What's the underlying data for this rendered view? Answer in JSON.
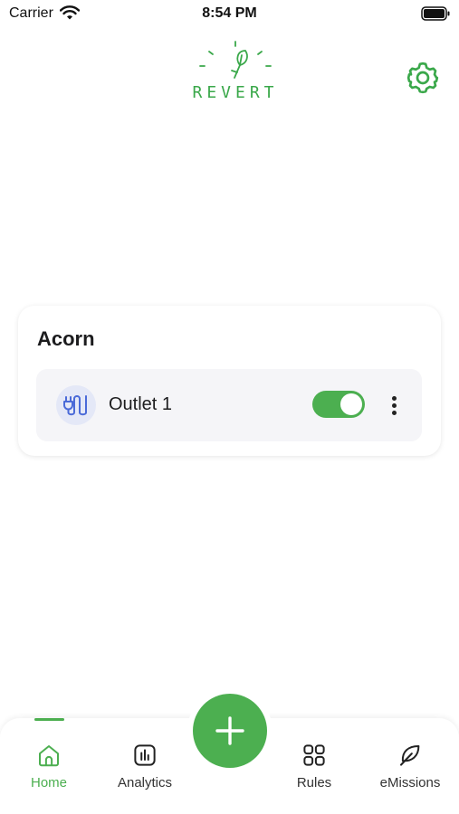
{
  "status_bar": {
    "carrier": "Carrier",
    "time": "8:54 PM"
  },
  "header": {
    "logo_text": "REVERT",
    "settings_icon": "gear-icon"
  },
  "device_group": {
    "name": "Acorn",
    "outlets": [
      {
        "name": "Outlet 1",
        "icon": "plug-icon",
        "power_on": true
      }
    ]
  },
  "tab_bar": {
    "tabs": [
      {
        "label": "Home",
        "icon": "home-icon",
        "active": true
      },
      {
        "label": "Analytics",
        "icon": "chart-icon",
        "active": false
      },
      {
        "label": "Rules",
        "icon": "grid-icon",
        "active": false
      },
      {
        "label": "eMissions",
        "icon": "leaf-icon",
        "active": false
      }
    ],
    "add_icon": "plus-icon"
  },
  "colors": {
    "accent": "#4caf50",
    "logo": "#3aa84a",
    "outlet_icon_bg": "#e4e8f7",
    "outlet_icon": "#4a6ad8"
  }
}
